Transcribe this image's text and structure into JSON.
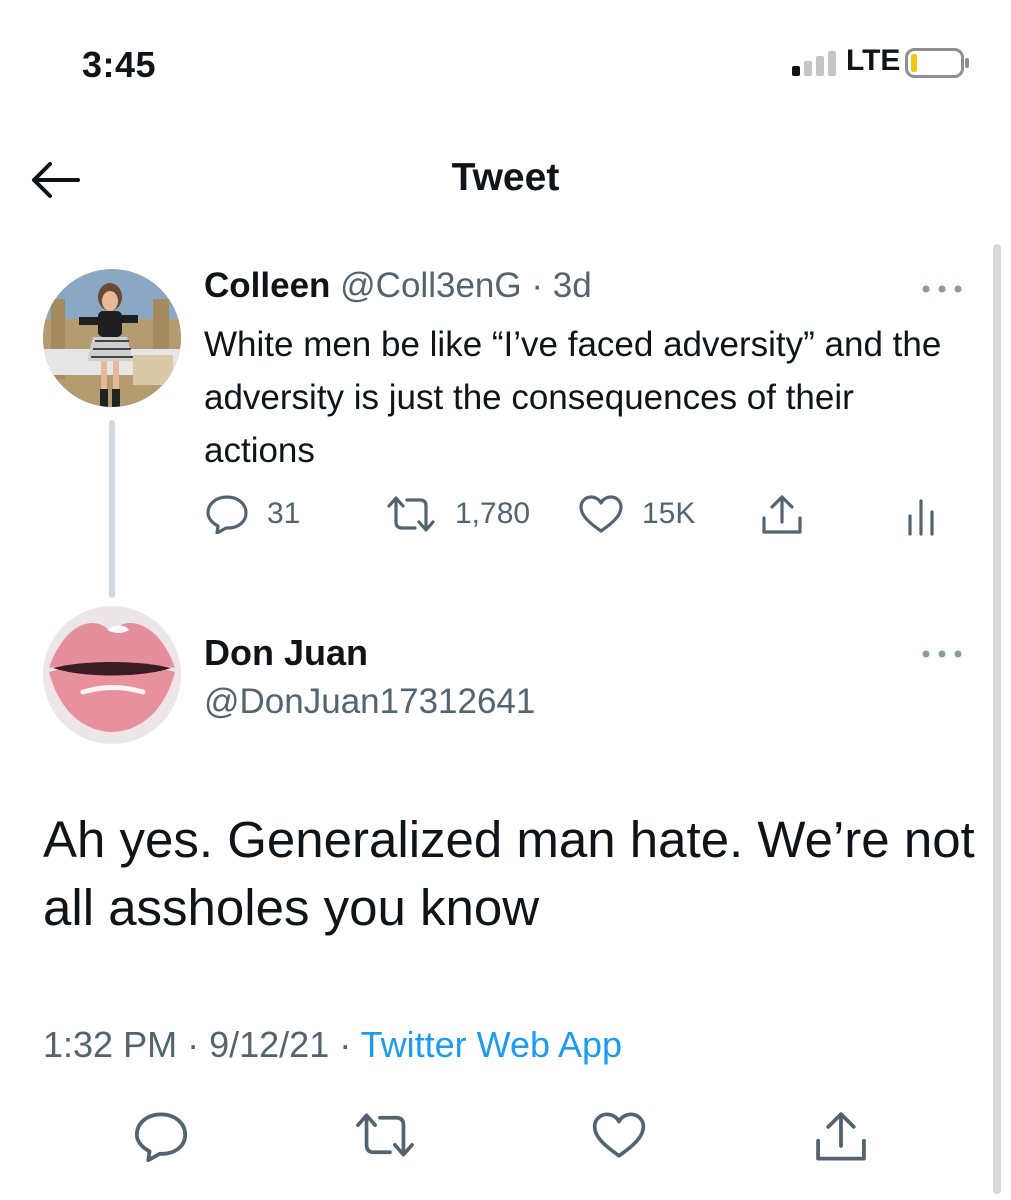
{
  "status_bar": {
    "time": "3:45",
    "network": "LTE",
    "icons": [
      "signal-icon",
      "battery-icon"
    ]
  },
  "header": {
    "title": "Tweet",
    "back_icon": "back-arrow-icon"
  },
  "original_tweet": {
    "name": "Colleen",
    "handle": "@Coll3enG",
    "time": "3d",
    "text": "White men be like “I’ve faced adversity” and the adversity is just the consequences of their actions",
    "replies": "31",
    "retweets": "1,780",
    "likes": "15K",
    "icons": [
      "reply-icon",
      "retweet-icon",
      "like-icon",
      "share-icon",
      "analytics-icon",
      "more-icon"
    ]
  },
  "main_tweet": {
    "name": "Don Juan",
    "handle": "@DonJuan17312641",
    "text": "Ah yes. Generalized man hate. We’re not all assholes you know",
    "time": "1:32 PM",
    "date": "9/12/21",
    "source": "Twitter Web App",
    "icons": [
      "reply-icon",
      "retweet-icon",
      "like-icon",
      "share-icon",
      "more-icon"
    ]
  },
  "colors": {
    "text": "#0f1419",
    "secondary": "#536471",
    "link": "#1d9bf0",
    "thread_line": "#cfd9de"
  }
}
